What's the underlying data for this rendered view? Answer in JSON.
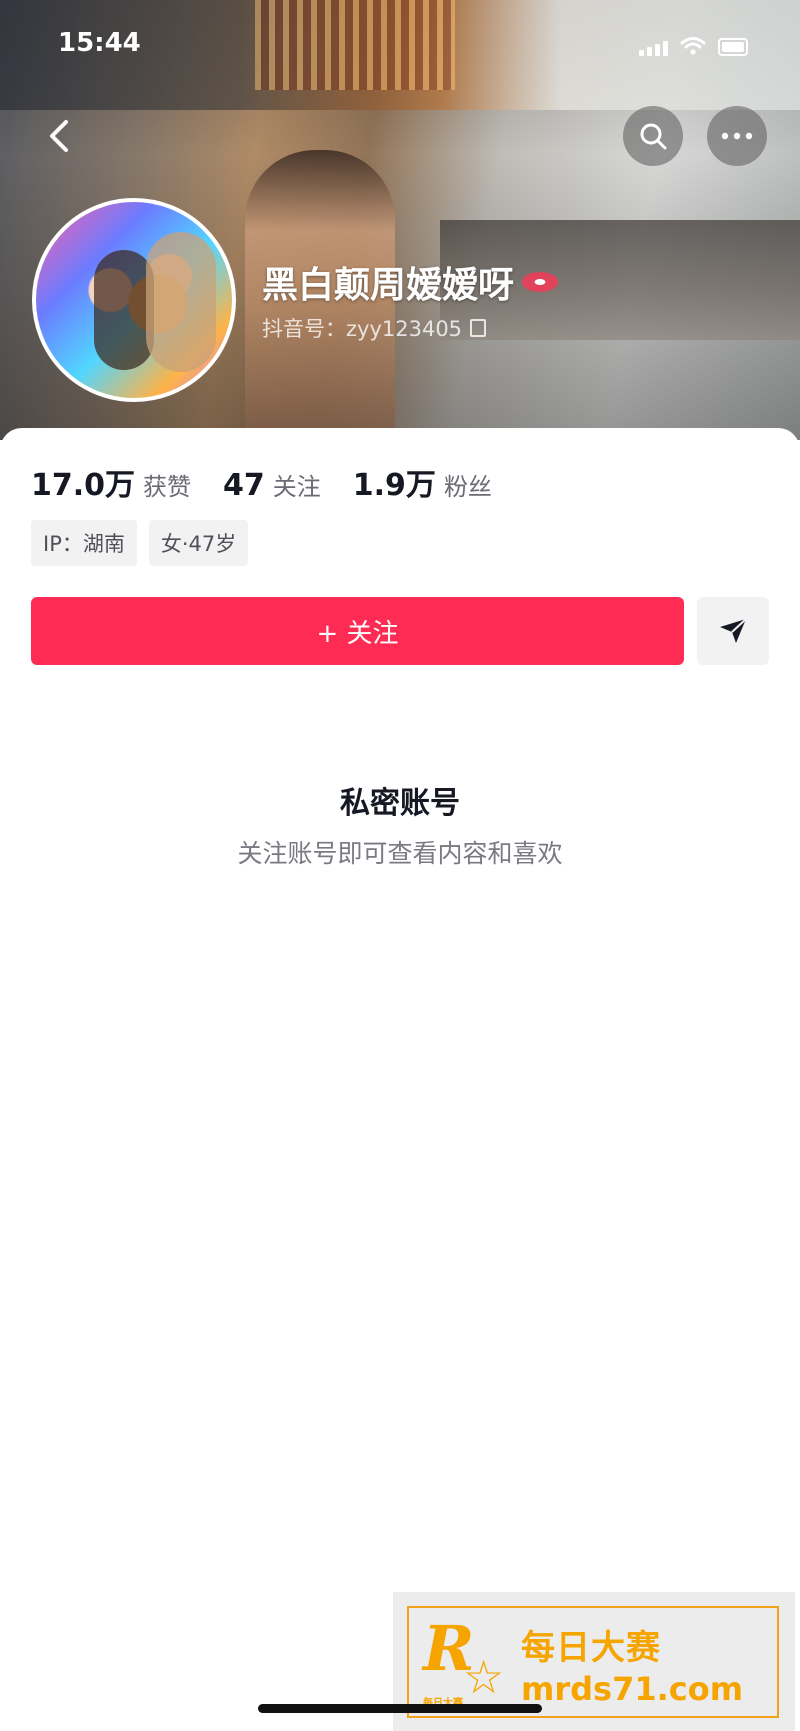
{
  "status_bar": {
    "time": "15:44",
    "icons": [
      "signal-icon",
      "wifi-icon",
      "battery-icon"
    ]
  },
  "top_nav": {
    "back_icon": "chevron-left-icon",
    "search_icon": "search-icon",
    "more_icon": "more-dots-icon"
  },
  "profile": {
    "nickname": "黑白颠周嫒嫒呀",
    "nickname_emoji_icon": "lips-icon",
    "douyin_id": "抖音号：zyy123405",
    "copy_icon": "copy-icon"
  },
  "stats": [
    {
      "value": "17.0万",
      "label": "获赞"
    },
    {
      "value": "47",
      "label": "关注"
    },
    {
      "value": "1.9万",
      "label": "粉丝"
    }
  ],
  "tags": [
    "IP：湖南",
    "女·47岁"
  ],
  "actions": {
    "follow_label": "+ 关注",
    "share_icon": "send-icon"
  },
  "private_notice": {
    "title": "私密账号",
    "subtitle": "关注账号即可查看内容和喜欢"
  },
  "watermark": {
    "logo_letter": "R",
    "logo_small": "每日大赛",
    "name": "每日大赛",
    "url": "mrds71.com"
  },
  "colors": {
    "follow_button": "#fe2c55",
    "watermark_accent": "#f5a400"
  }
}
